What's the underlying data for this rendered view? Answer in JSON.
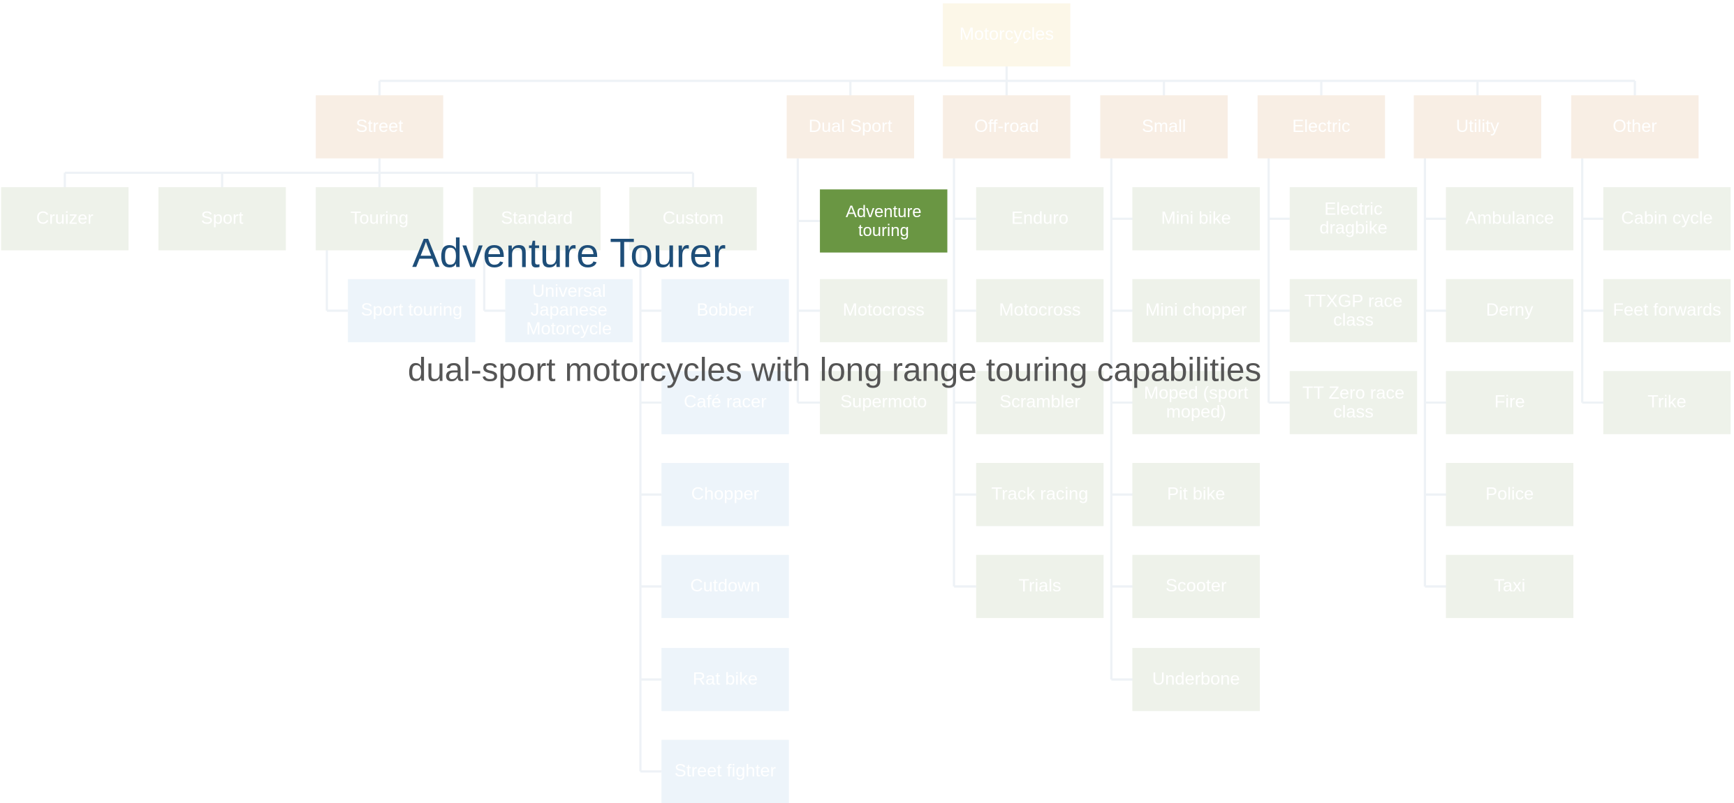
{
  "colors": {
    "root": "#fcf7e8",
    "category": "#f8eee4",
    "leaf": "#eef2ea",
    "subleaf": "#edf4fa",
    "highlight": "#6a9643",
    "connector": "#eef2f6",
    "title": "#1e4e79",
    "description": "#555555"
  },
  "tree": {
    "label": "Motorcycles",
    "children": [
      {
        "label": "Street",
        "children": [
          {
            "label": "Cruizer",
            "children": []
          },
          {
            "label": "Sport",
            "children": []
          },
          {
            "label": "Touring",
            "children": [
              {
                "label": "Sport touring"
              }
            ]
          },
          {
            "label": "Standard",
            "children": [
              {
                "label": "Universal Japanese Motorcycle"
              }
            ]
          },
          {
            "label": "Custom",
            "children": [
              {
                "label": "Bobber"
              },
              {
                "label": "Café racer"
              },
              {
                "label": "Chopper"
              },
              {
                "label": "Cutdown"
              },
              {
                "label": "Rat bike"
              },
              {
                "label": "Street fighter"
              }
            ]
          }
        ]
      },
      {
        "label": "Dual Sport",
        "children": [
          {
            "label": "Adventure touring",
            "highlighted": true
          },
          {
            "label": "Motocross"
          },
          {
            "label": "Supermoto"
          }
        ]
      },
      {
        "label": "Off-road",
        "children": [
          {
            "label": "Enduro"
          },
          {
            "label": "Motocross"
          },
          {
            "label": "Scrambler"
          },
          {
            "label": "Track racing"
          },
          {
            "label": "Trials"
          }
        ]
      },
      {
        "label": "Small",
        "children": [
          {
            "label": "Mini bike"
          },
          {
            "label": "Mini chopper"
          },
          {
            "label": "Moped (sport moped)"
          },
          {
            "label": "Pit bike"
          },
          {
            "label": "Scooter"
          },
          {
            "label": "Underbone"
          }
        ]
      },
      {
        "label": "Electric",
        "children": [
          {
            "label": "Electric dragbike"
          },
          {
            "label": "TTXGP race class"
          },
          {
            "label": "TT Zero race class"
          }
        ]
      },
      {
        "label": "Utility",
        "children": [
          {
            "label": "Ambulance"
          },
          {
            "label": "Derny"
          },
          {
            "label": "Fire"
          },
          {
            "label": "Police"
          },
          {
            "label": "Taxi"
          }
        ]
      },
      {
        "label": "Other",
        "children": [
          {
            "label": "Cabin cycle"
          },
          {
            "label": "Feet forwards"
          },
          {
            "label": "Trike"
          }
        ]
      }
    ]
  },
  "popup": {
    "title": "Adventure Tourer",
    "description": "dual-sport motorcycles with long range touring capabilities"
  }
}
